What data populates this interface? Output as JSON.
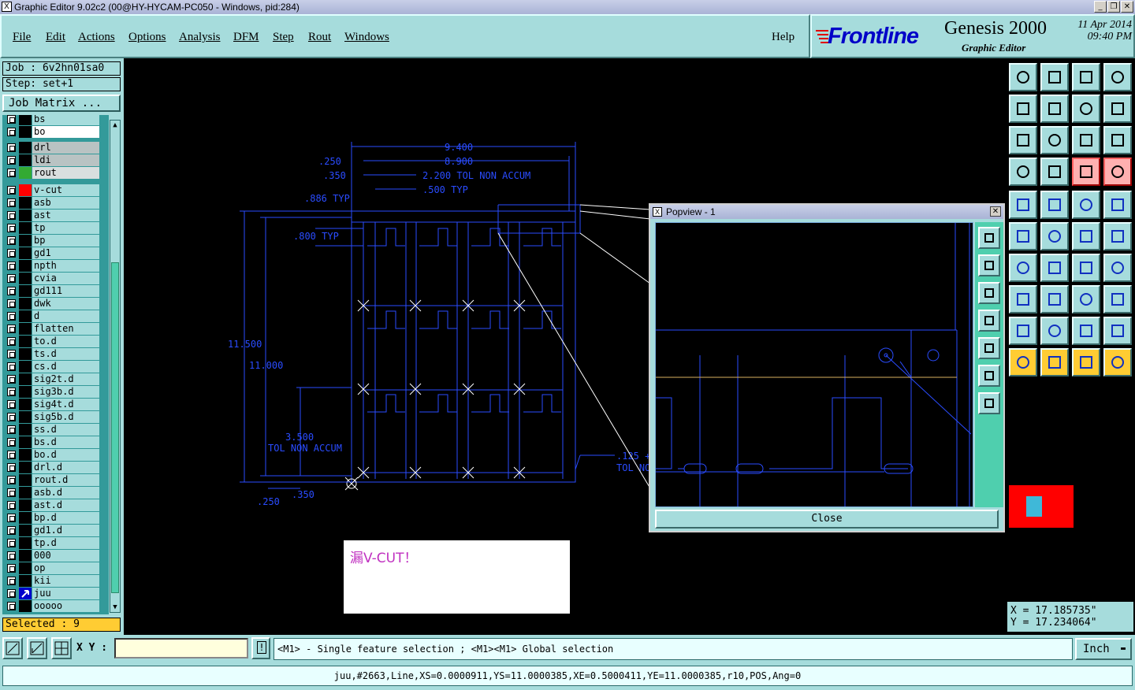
{
  "window": {
    "title": "Graphic Editor 9.02c2 (00@HY-HYCAM-PC050 - Windows, pid:284)",
    "icon": "X"
  },
  "menu": {
    "items": [
      "File",
      "Edit",
      "Actions",
      "Options",
      "Analysis",
      "DFM",
      "Step",
      "Rout",
      "Windows"
    ],
    "help": "Help"
  },
  "brand": {
    "logo": "Frontline",
    "product": "Genesis 2000",
    "subtitle": "Graphic Editor",
    "date": "11 Apr 2014",
    "time": "09:40 PM"
  },
  "job": {
    "job_label": "Job : 6v2hn01sa0",
    "step_label": "Step: set+1",
    "matrix_button": "Job Matrix ..."
  },
  "layers": [
    {
      "name": "bs",
      "color": "#000000",
      "partial": true
    },
    {
      "name": "bo",
      "color": "#000000",
      "highlight": "white"
    },
    {
      "name": "drl",
      "color": "#000000",
      "highlight": "gray"
    },
    {
      "name": "ldi",
      "color": "#000000",
      "highlight": "gray"
    },
    {
      "name": "rout",
      "color": "#33aa33",
      "highlight": "lightgray"
    },
    {
      "name": "v-cut",
      "color": "#ff0000"
    },
    {
      "name": "asb",
      "color": "#000000"
    },
    {
      "name": "ast",
      "color": "#000000"
    },
    {
      "name": "tp",
      "color": "#000000"
    },
    {
      "name": "bp",
      "color": "#000000"
    },
    {
      "name": "gd1",
      "color": "#000000"
    },
    {
      "name": "npth",
      "color": "#000000"
    },
    {
      "name": "cvia",
      "color": "#000000"
    },
    {
      "name": "gd111",
      "color": "#000000"
    },
    {
      "name": "dwk",
      "color": "#000000"
    },
    {
      "name": "d",
      "color": "#000000"
    },
    {
      "name": "flatten",
      "color": "#000000"
    },
    {
      "name": "to.d",
      "color": "#000000"
    },
    {
      "name": "ts.d",
      "color": "#000000"
    },
    {
      "name": "cs.d",
      "color": "#000000"
    },
    {
      "name": "sig2t.d",
      "color": "#000000"
    },
    {
      "name": "sig3b.d",
      "color": "#000000"
    },
    {
      "name": "sig4t.d",
      "color": "#000000"
    },
    {
      "name": "sig5b.d",
      "color": "#000000"
    },
    {
      "name": "ss.d",
      "color": "#000000"
    },
    {
      "name": "bs.d",
      "color": "#000000"
    },
    {
      "name": "bo.d",
      "color": "#000000"
    },
    {
      "name": "drl.d",
      "color": "#000000"
    },
    {
      "name": "rout.d",
      "color": "#000000"
    },
    {
      "name": "asb.d",
      "color": "#000000"
    },
    {
      "name": "ast.d",
      "color": "#000000"
    },
    {
      "name": "bp.d",
      "color": "#000000"
    },
    {
      "name": "gd1.d",
      "color": "#000000"
    },
    {
      "name": "tp.d",
      "color": "#000000"
    },
    {
      "name": "000",
      "color": "#000000"
    },
    {
      "name": "op",
      "color": "#000000"
    },
    {
      "name": "kii",
      "color": "#000000"
    },
    {
      "name": "juu",
      "color": "#0000cc",
      "work": true
    },
    {
      "name": "ooooo",
      "color": "#000000"
    }
  ],
  "selected": "Selected : 9",
  "coords": {
    "x": "X = 17.185735\"",
    "y": "Y = 17.234064\""
  },
  "drawing": {
    "dims": [
      "9.400",
      "8.900",
      ".250",
      ".350",
      "2.200 TOL NON ACCUM",
      ".500 TYP",
      ".886 TYP",
      ".800 TYP",
      "11.500",
      "11.000",
      "3.500",
      "TOL NON ACCUM",
      ".250",
      ".350",
      ".125 +",
      "TOL NO"
    ],
    "note": "漏V-CUT！"
  },
  "popview": {
    "title": "Popview - 1",
    "close": "Close"
  },
  "bottom": {
    "xy_label": "X Y :",
    "xy_value": "",
    "hint": "<M1> - Single feature selection ; <M1><M1> Global selection",
    "units": "Inch"
  },
  "status": "juu,#2663,Line,XS=0.0000911,YS=11.0000385,XE=0.5000411,YE=11.0000385,r10,POS,Ang=0",
  "colors": {
    "panel": "#a6dcdc",
    "drawing_line": "#2a4cff",
    "selection": "#ffcc33",
    "layer_red": "#ff0000"
  }
}
